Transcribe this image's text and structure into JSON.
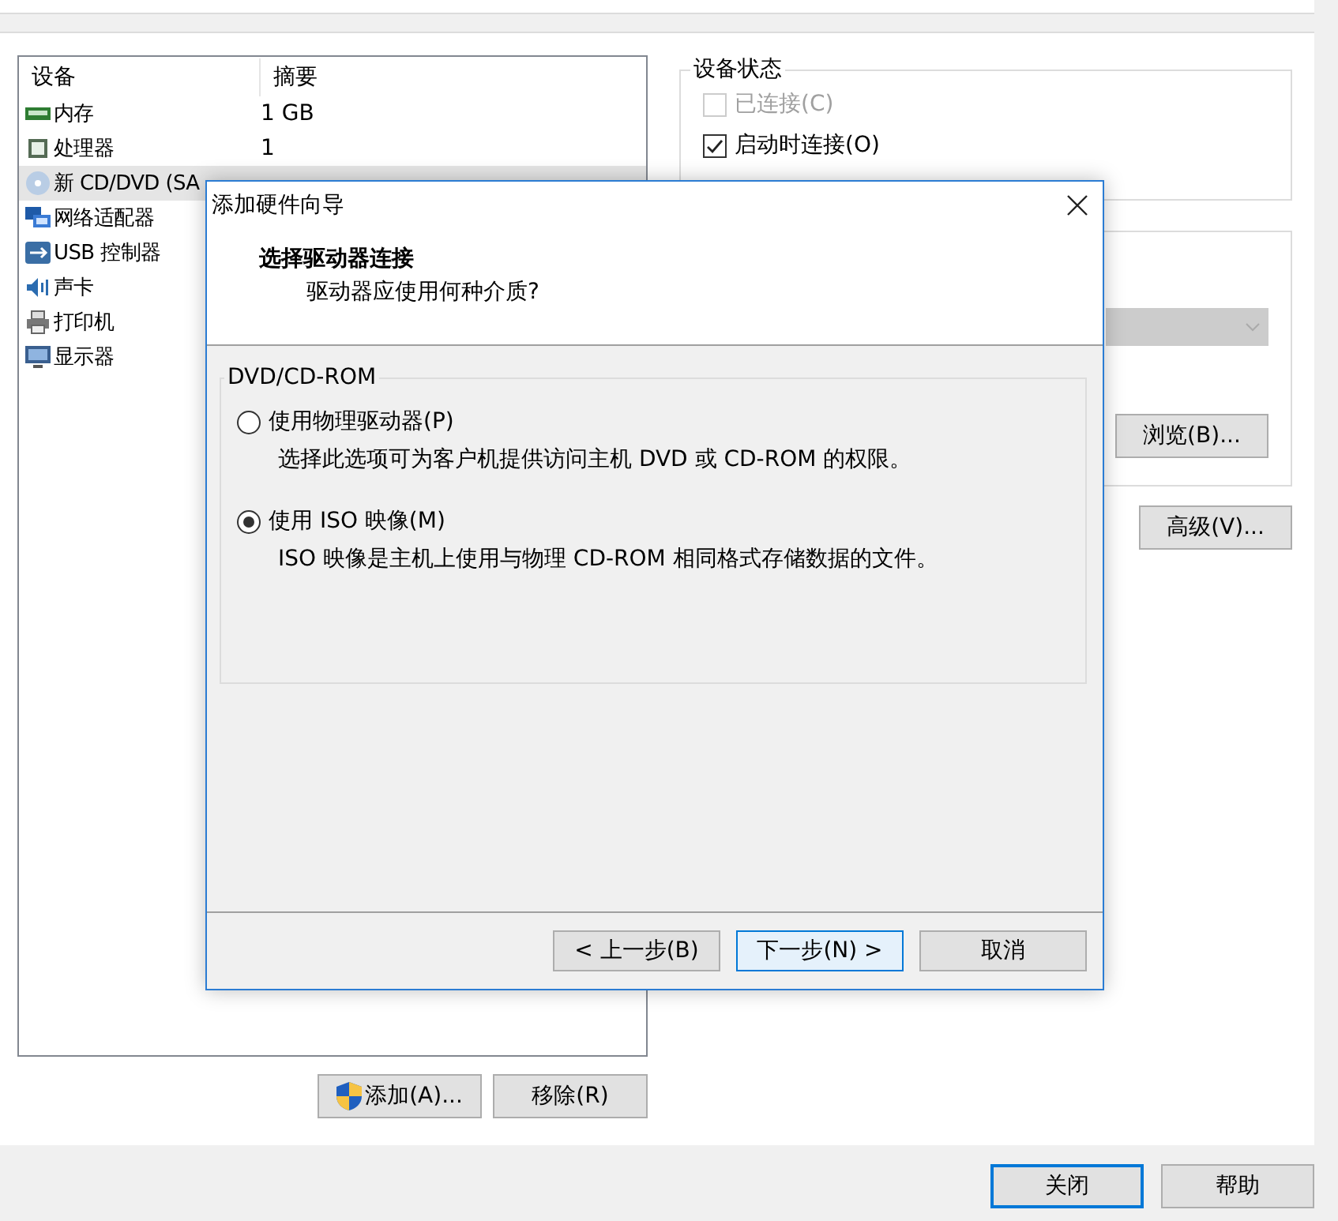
{
  "device_table": {
    "columns": [
      "设备",
      "摘要"
    ],
    "rows": [
      {
        "kind": "memory",
        "device": "内存",
        "summary": "1 GB",
        "selected": false
      },
      {
        "kind": "processor",
        "device": "处理器",
        "summary": "1",
        "selected": false
      },
      {
        "kind": "disc",
        "device": "新 CD/DVD (SA",
        "selected": true
      },
      {
        "kind": "network",
        "device": "网络适配器",
        "selected": false
      },
      {
        "kind": "usb",
        "device": "USB 控制器",
        "selected": false
      },
      {
        "kind": "sound",
        "device": "声卡",
        "selected": false
      },
      {
        "kind": "printer",
        "device": "打印机",
        "selected": false
      },
      {
        "kind": "display",
        "device": "显示器",
        "selected": false
      }
    ]
  },
  "device_status": {
    "title": "设备状态",
    "options": [
      {
        "label": "已连接(C)",
        "checked": false,
        "disabled": true
      },
      {
        "label": "启动时连接(O)",
        "checked": true,
        "disabled": false
      }
    ]
  },
  "connection": {
    "dropdown": {
      "disabled": true
    },
    "browse_button": "浏览(B)..."
  },
  "advanced_button": "高级(V)...",
  "add_button": "添加(A)...",
  "remove_button": "移除(R)",
  "footer_buttons": [
    {
      "label": "关闭",
      "default": true
    },
    {
      "label": "帮助",
      "default": false
    }
  ],
  "dialog": {
    "title": "添加硬件向导",
    "heading": "选择驱动器连接",
    "subheading": "驱动器应使用何种介质?",
    "group_title": "DVD/CD-ROM",
    "options": [
      {
        "label": "使用物理驱动器(P)",
        "description": "选择此选项可为客户机提供访问主机 DVD 或 CD-ROM 的权限。",
        "selected": false
      },
      {
        "label": "使用 ISO 映像(M)",
        "description": "ISO 映像是主机上使用与物理 CD-ROM 相同格式存储数据的文件。",
        "selected": true
      }
    ],
    "buttons": [
      {
        "label": "< 上一步(B)",
        "focused": false
      },
      {
        "label": "下一步(N) >",
        "focused": true
      },
      {
        "label": "取消",
        "focused": false
      }
    ]
  }
}
